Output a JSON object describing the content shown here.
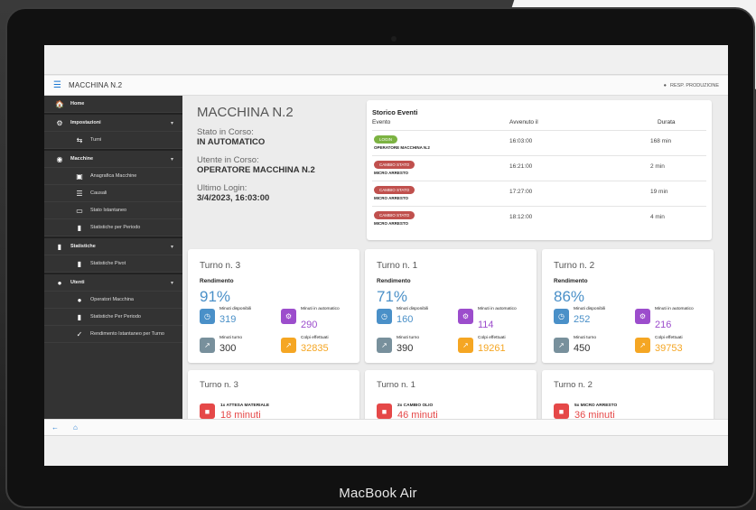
{
  "appbar": {
    "title": "MACCHINA N.2",
    "user": "RESP. PRODUZIONE"
  },
  "sidebar": [
    {
      "label": "Home",
      "icon": "home-icon",
      "glyph": "🏠",
      "level": "top",
      "chevron": ""
    },
    {
      "label": "Impostazioni",
      "icon": "gear-icon",
      "glyph": "⚙",
      "level": "top",
      "chevron": "▾"
    },
    {
      "label": "Turni",
      "icon": "shifts-icon",
      "glyph": "⇆",
      "level": "sub",
      "chevron": ""
    },
    {
      "label": "Macchine",
      "icon": "machines-icon",
      "glyph": "◉",
      "level": "top",
      "chevron": "▾"
    },
    {
      "label": "Anagrafica Macchine",
      "icon": "briefcase-icon",
      "glyph": "▣",
      "level": "sub",
      "chevron": ""
    },
    {
      "label": "Causali",
      "icon": "list-icon",
      "glyph": "☰",
      "level": "sub",
      "chevron": ""
    },
    {
      "label": "Stato Istantaneo",
      "icon": "monitor-icon",
      "glyph": "▭",
      "level": "sub",
      "chevron": ""
    },
    {
      "label": "Statistiche per Periodo",
      "icon": "bar-chart-icon",
      "glyph": "▮",
      "level": "sub",
      "chevron": ""
    },
    {
      "label": "Statistiche",
      "icon": "bar-chart-icon",
      "glyph": "▮",
      "level": "top",
      "chevron": "▾"
    },
    {
      "label": "Statistiche Pivot",
      "icon": "bar-chart-icon",
      "glyph": "▮",
      "level": "sub",
      "chevron": ""
    },
    {
      "label": "Utenti",
      "icon": "user-icon",
      "glyph": "●",
      "level": "top",
      "chevron": "▾"
    },
    {
      "label": "Operatori Macchina",
      "icon": "user-icon",
      "glyph": "●",
      "level": "sub",
      "chevron": ""
    },
    {
      "label": "Statistiche Per Periodo",
      "icon": "bar-chart-icon",
      "glyph": "▮",
      "level": "sub",
      "chevron": ""
    },
    {
      "label": "Rendimento Istantaneo per Turno",
      "icon": "check-icon",
      "glyph": "✓",
      "level": "sub",
      "chevron": ""
    }
  ],
  "machine": {
    "title": "MACCHINA N.2",
    "state_label": "Stato in Corso:",
    "state_value": "IN AUTOMATICO",
    "user_label": "Utente in Corso:",
    "user_value": "OPERATORE MACCHINA N.2",
    "login_label": "Ultimo Login:",
    "login_value": "3/4/2023, 16:03:00"
  },
  "events": {
    "title": "Storico Eventi",
    "col_event": "Evento",
    "col_time": "Avvenuto il",
    "col_duration": "Durata",
    "rows": [
      {
        "badge": "LOGIN",
        "badge_color": "#7cb342",
        "detail": "OPERATORE MACCHINA N.2",
        "time": "16:03:00",
        "duration": "168 min"
      },
      {
        "badge": "CAMBIO STATO",
        "badge_color": "#c0504d",
        "detail": "MICRO ARRESTO",
        "time": "16:21:00",
        "duration": "2 min"
      },
      {
        "badge": "CAMBIO STATO",
        "badge_color": "#c0504d",
        "detail": "MICRO ARRESTO",
        "time": "17:27:00",
        "duration": "19 min"
      },
      {
        "badge": "CAMBIO STATO",
        "badge_color": "#c0504d",
        "detail": "MICRO ARRESTO",
        "time": "18:12:00",
        "duration": "4 min"
      }
    ]
  },
  "turni": [
    {
      "title": "Turno n. 3",
      "rend_label": "Rendimento",
      "rend": "91%",
      "disp_label": "Minuti disponibili",
      "disp": "319",
      "auto_label": "Minuti in automatico",
      "auto": "290",
      "turno_label": "Minuti turno",
      "turno": "300",
      "colpi_label": "Colpi effettuati",
      "colpi": "32835"
    },
    {
      "title": "Turno n. 1",
      "rend_label": "Rendimento",
      "rend": "71%",
      "disp_label": "Minuti disponibili",
      "disp": "160",
      "auto_label": "Minuti in automatico",
      "auto": "114",
      "turno_label": "Minuti turno",
      "turno": "390",
      "colpi_label": "Colpi effettuati",
      "colpi": "19261"
    },
    {
      "title": "Turno n. 2",
      "rend_label": "Rendimento",
      "rend": "86%",
      "disp_label": "Minuti disponibili",
      "disp": "252",
      "auto_label": "Minuti in automatico",
      "auto": "216",
      "turno_label": "Minuti turno",
      "turno": "450",
      "colpi_label": "Colpi effettuati",
      "colpi": "39753"
    }
  ],
  "stops": [
    {
      "title": "Turno n. 3",
      "label": "1x ATTESA MATERIALE",
      "value": "18 minuti"
    },
    {
      "title": "Turno n. 1",
      "label": "2x CAMBIO OLIO",
      "value": "46 minuti"
    },
    {
      "title": "Turno n. 2",
      "label": "5x MICRO ARRESTO",
      "value": "36 minuti"
    }
  ],
  "colors": {
    "blue": "#4a90c8",
    "purple": "#9c4dcc",
    "gray": "#78909c",
    "orange": "#f5a623",
    "red": "#e54848"
  },
  "bottom": {
    "back_icon": "←",
    "home_icon": "⌂"
  },
  "device": {
    "brand": "MacBook Air"
  }
}
